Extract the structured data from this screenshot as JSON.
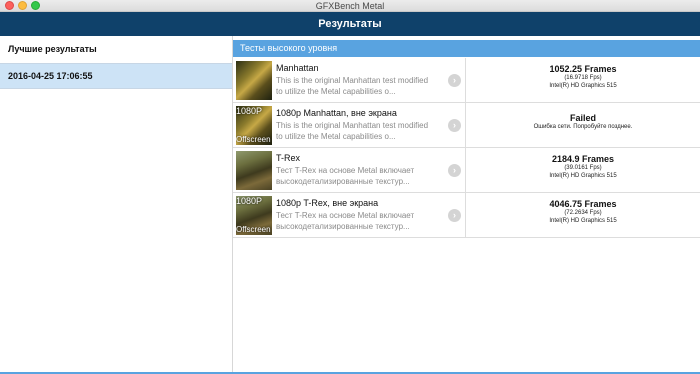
{
  "window": {
    "title": "GFXBench Metal"
  },
  "header": {
    "title": "Результаты"
  },
  "sidebar": {
    "title": "Лучшие результаты",
    "items": [
      {
        "label": "2016-04-25 17:06:55"
      }
    ]
  },
  "section": {
    "title": "Тесты высокого уровня"
  },
  "tests": [
    {
      "name": "Manhattan",
      "description": "This is the original Manhattan test modified\nto utilize the Metal capabilities o...",
      "thumb_tag_top": "",
      "thumb_tag_bottom": "",
      "result_main": "1052.25 Frames",
      "result_sub": "(16.9718 Fps)",
      "result_device": "Intel(R) HD Graphics 515"
    },
    {
      "name": "1080p Manhattan, вне экрана",
      "description": "This is the original Manhattan test modified\nto utilize the Metal capabilities o...",
      "thumb_tag_top": "1080P",
      "thumb_tag_bottom": "Offscreen",
      "result_main": "Failed",
      "result_sub": "Ошибка сети. Попробуйте позднее.",
      "result_device": ""
    },
    {
      "name": "T-Rex",
      "description": "Тест T-Rex на основе Metal включает\nвысокодетализированные текстур...",
      "thumb_tag_top": "",
      "thumb_tag_bottom": "",
      "result_main": "2184.9 Frames",
      "result_sub": "(39.0161 Fps)",
      "result_device": "Intel(R) HD Graphics 515"
    },
    {
      "name": "1080p T-Rex, вне экрана",
      "description": "Тест T-Rex на основе Metal включает\nвысокодетализированные текстур...",
      "thumb_tag_top": "1080P",
      "thumb_tag_bottom": "Offscreen",
      "result_main": "4046.75 Frames",
      "result_sub": "(72.2634 Fps)",
      "result_device": "Intel(R) HD Graphics 515"
    }
  ],
  "icons": {
    "row_chevron": "chevron-right-icon",
    "chevron_glyph": "›"
  },
  "colors": {
    "header_bg": "#0f416a",
    "section_bg": "#59a3e0",
    "selected_bg": "#cde3f6"
  }
}
